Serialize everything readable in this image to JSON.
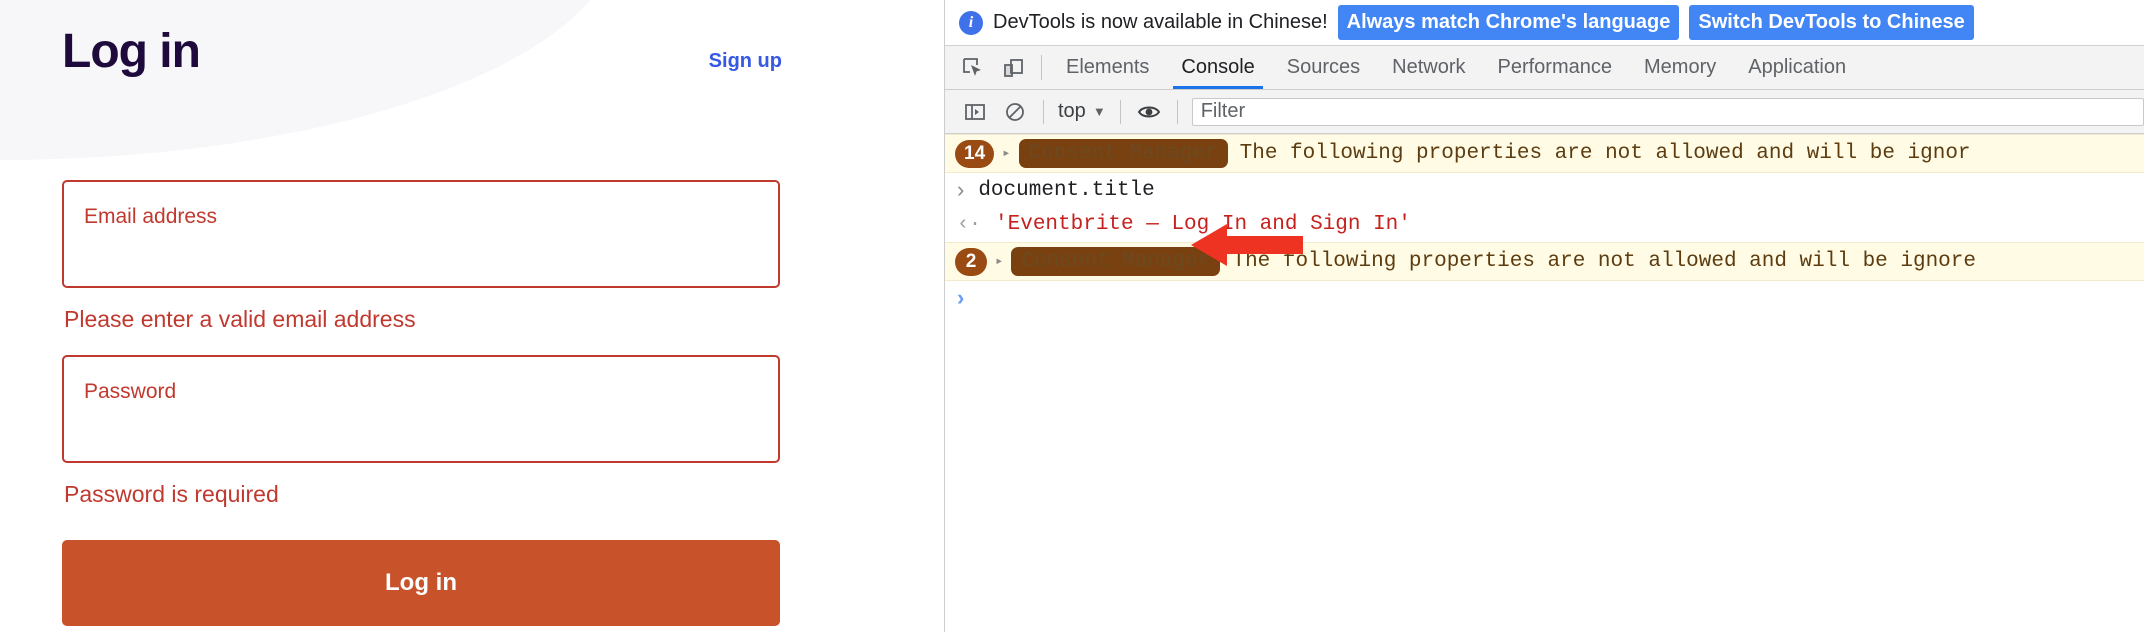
{
  "login": {
    "title": "Log in",
    "signup_link": "Sign up",
    "email": {
      "label": "Email address",
      "value": "",
      "placeholder": "",
      "error": "Please enter a valid email address"
    },
    "password": {
      "label": "Password",
      "value": "",
      "placeholder": "",
      "error": "Password is required"
    },
    "submit_label": "Log in",
    "colors": {
      "title": "#1e0a3c",
      "link": "#3659e3",
      "error": "#c0392f",
      "button": "#c8522a",
      "hero_bg": "#f7f7fa"
    }
  },
  "devtools": {
    "infobar": {
      "icon": "info-icon",
      "message": "DevTools is now available in Chinese!",
      "primary_button": "Always match Chrome's language",
      "secondary_button": "Switch DevTools to Chinese",
      "button_color": "#4285f4"
    },
    "toolbar_icons": [
      {
        "name": "inspect-element-icon"
      },
      {
        "name": "device-toolbar-icon"
      }
    ],
    "tabs": [
      {
        "label": "Elements",
        "active": false
      },
      {
        "label": "Console",
        "active": true
      },
      {
        "label": "Sources",
        "active": false
      },
      {
        "label": "Network",
        "active": false
      },
      {
        "label": "Performance",
        "active": false
      },
      {
        "label": "Memory",
        "active": false
      },
      {
        "label": "Application",
        "active": false
      }
    ],
    "console_toolbar": {
      "sidebar_toggle_icon": "console-sidebar-icon",
      "clear_icon": "clear-console-icon",
      "context": "top",
      "context_caret": "▼",
      "eye_icon": "live-expression-eye-icon",
      "filter_placeholder": "Filter",
      "filter_value": ""
    },
    "messages": [
      {
        "type": "warning",
        "count": "14",
        "disclosure": "▸",
        "tag": "Consent Manager",
        "text": "The following properties are not allowed and will be ignor"
      },
      {
        "type": "command",
        "chevron": "›",
        "text": "document.title"
      },
      {
        "type": "result",
        "chevron": "‹·",
        "text": "'Eventbrite — Log In and Sign In'"
      },
      {
        "type": "warning",
        "count": "2",
        "disclosure": "▸",
        "tag": "Consent Manager",
        "text": "The following properties are not allowed and will be ignore"
      },
      {
        "type": "prompt",
        "chevron": "›",
        "text": ""
      }
    ],
    "colors": {
      "warning_bg": "#fffbe5",
      "warning_text": "#5c3c10",
      "badge_bg": "#9a4b13",
      "tag_bg": "#7a4110",
      "result_text": "#c5221f",
      "active_tab_underline": "#1a73e8"
    }
  },
  "annotation": {
    "arrow": "red-arrow-pointing-left",
    "color": "#ee3322"
  }
}
